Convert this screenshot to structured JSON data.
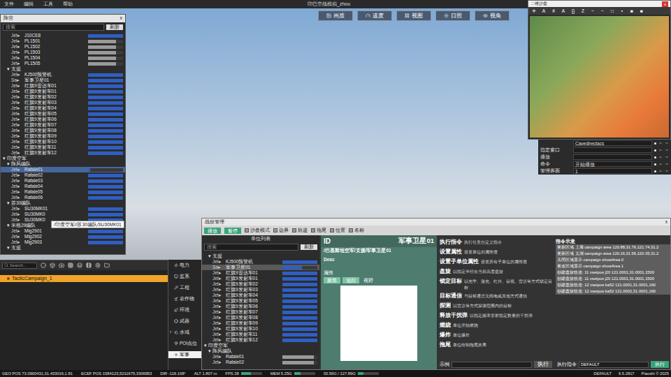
{
  "window": {
    "title": "印巴空战模拟_zhou"
  },
  "menu": [
    "文件",
    "编辑",
    "工具",
    "帮助"
  ],
  "viewport_toolbar": [
    {
      "label": "画质"
    },
    {
      "label": "速度"
    },
    {
      "label": "视图"
    },
    {
      "label": "日照"
    },
    {
      "label": "视角"
    }
  ],
  "camp_panel": {
    "title": "阵营",
    "close": "x",
    "search": {
      "placeholder": "搜索"
    },
    "refresh": "刷新",
    "rows": [
      {
        "kind": "unit",
        "indent": 2,
        "type": "Jet",
        "arrow": "▸",
        "name": "J10CE8",
        "level": 1,
        "color": "#2f5fc4",
        "selected": false
      },
      {
        "kind": "unit",
        "indent": 2,
        "type": "Jet",
        "arrow": "▸",
        "name": "PL1501",
        "level": 0.8,
        "color": "#9a9a9a",
        "selected": false
      },
      {
        "kind": "unit",
        "indent": 2,
        "type": "Jet",
        "arrow": "▸",
        "name": "PL1502",
        "level": 0.8,
        "color": "#9a9a9a",
        "selected": false
      },
      {
        "kind": "unit",
        "indent": 2,
        "type": "Jet",
        "arrow": "▸",
        "name": "PL1503",
        "level": 0.8,
        "color": "#9a9a9a",
        "selected": false
      },
      {
        "kind": "unit",
        "indent": 2,
        "type": "Jet",
        "arrow": "▸",
        "name": "PL1504",
        "level": 0.8,
        "color": "#9a9a9a",
        "selected": false
      },
      {
        "kind": "unit",
        "indent": 2,
        "type": "Jet",
        "arrow": "▸",
        "name": "PL1505",
        "level": 0.8,
        "color": "#9a9a9a",
        "selected": false
      },
      {
        "kind": "group",
        "indent": 1,
        "arrow": "▾",
        "name": "支援",
        "expanded": true,
        "selected": false
      },
      {
        "kind": "unit",
        "indent": 2,
        "type": "Jet",
        "arrow": "▸",
        "name": "KJ500预警机",
        "level": 1,
        "color": "#2f5fc4",
        "selected": false
      },
      {
        "kind": "unit",
        "indent": 2,
        "type": "Sa",
        "arrow": "▸",
        "name": "军事卫星01",
        "level": 1,
        "color": "#2f5fc4",
        "selected": false
      },
      {
        "kind": "unit",
        "indent": 2,
        "type": "Jet",
        "arrow": "▸",
        "name": "红旗9雷达车01",
        "level": 1,
        "color": "#2f5fc4",
        "selected": false
      },
      {
        "kind": "unit",
        "indent": 2,
        "type": "Jet",
        "arrow": "▸",
        "name": "红旗9发射车01",
        "level": 1,
        "color": "#2f5fc4",
        "selected": false
      },
      {
        "kind": "unit",
        "indent": 2,
        "type": "Jet",
        "arrow": "▸",
        "name": "红旗9发射车02",
        "level": 1,
        "color": "#2f5fc4",
        "selected": false
      },
      {
        "kind": "unit",
        "indent": 2,
        "type": "Jet",
        "arrow": "▸",
        "name": "红旗9发射车03",
        "level": 1,
        "color": "#2f5fc4",
        "selected": false
      },
      {
        "kind": "unit",
        "indent": 2,
        "type": "Jet",
        "arrow": "▸",
        "name": "红旗9发射车04",
        "level": 1,
        "color": "#2f5fc4",
        "selected": false
      },
      {
        "kind": "unit",
        "indent": 2,
        "type": "Jet",
        "arrow": "▸",
        "name": "红旗9发射车05",
        "level": 1,
        "color": "#2f5fc4",
        "selected": false
      },
      {
        "kind": "unit",
        "indent": 2,
        "type": "Jet",
        "arrow": "▸",
        "name": "红旗9发射车06",
        "level": 1,
        "color": "#2f5fc4",
        "selected": false
      },
      {
        "kind": "unit",
        "indent": 2,
        "type": "Jet",
        "arrow": "▸",
        "name": "红旗9发射车07",
        "level": 1,
        "color": "#2f5fc4",
        "selected": false
      },
      {
        "kind": "unit",
        "indent": 2,
        "type": "Jet",
        "arrow": "▸",
        "name": "红旗9发射车08",
        "level": 1,
        "color": "#2f5fc4",
        "selected": false
      },
      {
        "kind": "unit",
        "indent": 2,
        "type": "Jet",
        "arrow": "▸",
        "name": "红旗9发射车09",
        "level": 1,
        "color": "#2f5fc4",
        "selected": false
      },
      {
        "kind": "unit",
        "indent": 2,
        "type": "Jet",
        "arrow": "▸",
        "name": "红旗9发射车10",
        "level": 1,
        "color": "#2f5fc4",
        "selected": false
      },
      {
        "kind": "unit",
        "indent": 2,
        "type": "Jet",
        "arrow": "▸",
        "name": "红旗9发射车11",
        "level": 1,
        "color": "#2f5fc4",
        "selected": false
      },
      {
        "kind": "unit",
        "indent": 2,
        "type": "Jet",
        "arrow": "▸",
        "name": "红旗9发射车12",
        "level": 1,
        "color": "#2f5fc4",
        "selected": false
      },
      {
        "kind": "group",
        "indent": 0,
        "arrow": "▾",
        "name": "印度空军",
        "expanded": true,
        "selected": false
      },
      {
        "kind": "group",
        "indent": 1,
        "arrow": "▾",
        "name": "阵风编队",
        "expanded": true,
        "selected": false
      },
      {
        "kind": "unit",
        "indent": 2,
        "type": "Jet",
        "arrow": "▸",
        "name": "Rafale01",
        "level": 0.06,
        "color": "#2f5fc4",
        "selected": true
      },
      {
        "kind": "unit",
        "indent": 2,
        "type": "Jet",
        "arrow": "▸",
        "name": "Rafale02",
        "level": 1,
        "color": "#2f5fc4",
        "selected": false
      },
      {
        "kind": "unit",
        "indent": 2,
        "type": "Jet",
        "arrow": "▸",
        "name": "Rafale03",
        "level": 1,
        "color": "#2f5fc4",
        "selected": false
      },
      {
        "kind": "unit",
        "indent": 2,
        "type": "Jet",
        "arrow": "▸",
        "name": "Rafale04",
        "level": 1,
        "color": "#2f5fc4",
        "selected": false
      },
      {
        "kind": "unit",
        "indent": 2,
        "type": "Jet",
        "arrow": "▸",
        "name": "Rafale05",
        "level": 1,
        "color": "#2f5fc4",
        "selected": false
      },
      {
        "kind": "unit",
        "indent": 2,
        "type": "Jet",
        "arrow": "▸",
        "name": "Rafale06",
        "level": 1,
        "color": "#2f5fc4",
        "selected": false
      },
      {
        "kind": "group",
        "indent": 1,
        "arrow": "▾",
        "name": "苏30编队",
        "expanded": true,
        "selected": false
      },
      {
        "kind": "unit",
        "indent": 2,
        "type": "Jet",
        "arrow": "▸",
        "name": "SU30MK01",
        "level": 1,
        "color": "#2f5fc4",
        "selected": false
      },
      {
        "kind": "unit",
        "indent": 2,
        "type": "Jet",
        "arrow": "▸",
        "name": "SU30MK0",
        "level": 1,
        "color": "#2f5fc4",
        "selected": false
      },
      {
        "kind": "unit",
        "indent": 2,
        "type": "Jet",
        "arrow": "▸",
        "name": "SU30MK0",
        "level": 1,
        "color": "#2f5fc4",
        "selected": false
      },
      {
        "kind": "group",
        "indent": 1,
        "arrow": "▾",
        "name": "米格29编队",
        "expanded": true,
        "selected": false
      },
      {
        "kind": "unit",
        "indent": 2,
        "type": "Jet",
        "arrow": "▸",
        "name": "Mig2901",
        "level": 1,
        "color": "#2f5fc4",
        "selected": false
      },
      {
        "kind": "unit",
        "indent": 2,
        "type": "Jet",
        "arrow": "▸",
        "name": "Mig2902",
        "level": 1,
        "color": "#2f5fc4",
        "selected": false
      },
      {
        "kind": "unit",
        "indent": 2,
        "type": "Jet",
        "arrow": "▸",
        "name": "Mig2903",
        "level": 1,
        "color": "#2f5fc4",
        "selected": false
      },
      {
        "kind": "group",
        "indent": 1,
        "arrow": "▾",
        "name": "支援",
        "expanded": true,
        "selected": false
      }
    ]
  },
  "tooltip": "/印度空军//苏30编队/SU30MK01",
  "minimap": {
    "title": "二维沙盘",
    "close": "x",
    "tools": [
      "✛",
      "A",
      "#",
      "A",
      "{}",
      "Z",
      "~",
      "~",
      "□",
      "▪",
      "■",
      "■"
    ]
  },
  "props": [
    {
      "value": "Cavedirectacs"
    },
    {
      "label": "指定窗口"
    },
    {
      "label": "播放"
    },
    {
      "label": "命令",
      "value": "开始播放"
    },
    {
      "label": "管理界面",
      "value": "1"
    }
  ],
  "assets": {
    "search": {
      "placeholder": "Search..."
    },
    "items": [
      {
        "label": "TacticCampaign_1",
        "selected": true
      }
    ]
  },
  "categories": [
    {
      "label": "电力",
      "selected": false
    },
    {
      "label": "监系",
      "selected": false
    },
    {
      "label": "工程",
      "selected": false
    },
    {
      "label": "农作物",
      "selected": false
    },
    {
      "label": "环境",
      "selected": false
    },
    {
      "label": "武器",
      "selected": false
    },
    {
      "label": "水域",
      "arrow": "›",
      "selected": false
    },
    {
      "label": "POI点位",
      "selected": false
    },
    {
      "label": "军事",
      "selected": true
    }
  ],
  "battle": {
    "title": "战役管理",
    "close": "x",
    "buttons": [
      {
        "label": "播放"
      },
      {
        "label": "暂停"
      }
    ],
    "toggles": [
      {
        "label": "沙盘模式",
        "checked": false
      },
      {
        "label": "边界",
        "checked": false
      },
      {
        "label": "轨迹",
        "checked": false
      },
      {
        "label": "拖尾",
        "checked": false
      },
      {
        "label": "位置",
        "checked": false
      },
      {
        "label": "名称",
        "checked": false
      }
    ],
    "unit_list": {
      "title": "单位列表",
      "search": {
        "placeholder": "搜索"
      },
      "refresh": "刷新",
      "rows": [
        {
          "kind": "group",
          "indent": 1,
          "arrow": "▾",
          "name": "支援",
          "expanded": true,
          "selected": false
        },
        {
          "kind": "unit",
          "indent": 2,
          "type": "Jet",
          "arrow": "▸",
          "name": "KJ500预警机",
          "level": 1,
          "color": "#2f5fc4",
          "selected": false
        },
        {
          "kind": "unit",
          "indent": 2,
          "type": "Sa",
          "arrow": "▸",
          "name": "军事卫星01",
          "level": 0.55,
          "color": "#2f5fc4",
          "selected": true
        },
        {
          "kind": "unit",
          "indent": 2,
          "type": "Jet",
          "arrow": "▸",
          "name": "红旗9雷达车01",
          "level": 1,
          "color": "#2f5fc4",
          "selected": false
        },
        {
          "kind": "unit",
          "indent": 2,
          "type": "Jet",
          "arrow": "▸",
          "name": "红旗9发射车01",
          "level": 1,
          "color": "#2f5fc4",
          "selected": false
        },
        {
          "kind": "unit",
          "indent": 2,
          "type": "Jet",
          "arrow": "▸",
          "name": "红旗9发射车02",
          "level": 1,
          "color": "#2f5fc4",
          "selected": false
        },
        {
          "kind": "unit",
          "indent": 2,
          "type": "Jet",
          "arrow": "▸",
          "name": "红旗9发射车03",
          "level": 1,
          "color": "#2f5fc4",
          "selected": false
        },
        {
          "kind": "unit",
          "indent": 2,
          "type": "Jet",
          "arrow": "▸",
          "name": "红旗9发射车04",
          "level": 1,
          "color": "#2f5fc4",
          "selected": false
        },
        {
          "kind": "unit",
          "indent": 2,
          "type": "Jet",
          "arrow": "▸",
          "name": "红旗9发射车05",
          "level": 1,
          "color": "#2f5fc4",
          "selected": false
        },
        {
          "kind": "unit",
          "indent": 2,
          "type": "Jet",
          "arrow": "▸",
          "name": "红旗9发射车06",
          "level": 1,
          "color": "#2f5fc4",
          "selected": false
        },
        {
          "kind": "unit",
          "indent": 2,
          "type": "Jet",
          "arrow": "▸",
          "name": "红旗9发射车07",
          "level": 1,
          "color": "#2f5fc4",
          "selected": false
        },
        {
          "kind": "unit",
          "indent": 2,
          "type": "Jet",
          "arrow": "▸",
          "name": "红旗9发射车08",
          "level": 1,
          "color": "#2f5fc4",
          "selected": false
        },
        {
          "kind": "unit",
          "indent": 2,
          "type": "Jet",
          "arrow": "▸",
          "name": "红旗9发射车09",
          "level": 1,
          "color": "#2f5fc4",
          "selected": false
        },
        {
          "kind": "unit",
          "indent": 2,
          "type": "Jet",
          "arrow": "▸",
          "name": "红旗9发射车10",
          "level": 1,
          "color": "#2f5fc4",
          "selected": false
        },
        {
          "kind": "unit",
          "indent": 2,
          "type": "Jet",
          "arrow": "▸",
          "name": "红旗9发射车11",
          "level": 1,
          "color": "#2f5fc4",
          "selected": false
        },
        {
          "kind": "unit",
          "indent": 2,
          "type": "Jet",
          "arrow": "▸",
          "name": "红旗9发射车12",
          "level": 1,
          "color": "#2f5fc4",
          "selected": false
        },
        {
          "kind": "group",
          "indent": 0,
          "arrow": "▾",
          "name": "印度空军",
          "expanded": true,
          "selected": false
        },
        {
          "kind": "group",
          "indent": 1,
          "arrow": "▾",
          "name": "阵风编队",
          "expanded": true,
          "selected": false
        },
        {
          "kind": "unit",
          "indent": 2,
          "type": "Jet",
          "arrow": "▸",
          "name": "Rafale01",
          "level": 0.9,
          "color": "#9a9a9a",
          "selected": false
        },
        {
          "kind": "unit",
          "indent": 2,
          "type": "Jet",
          "arrow": "▸",
          "name": "Rafale02",
          "level": 0.9,
          "color": "#9a9a9a",
          "selected": false
        }
      ]
    },
    "info": {
      "id_label": "ID",
      "name": "军事卫星01",
      "path": "/巴基斯坦空军/支援/军事卫星01",
      "desc_label": "Desc",
      "attr_label": "属性",
      "tabs": [
        {
          "label": "聚焦",
          "selected": true
        },
        {
          "label": "追踪",
          "selected": true
        },
        {
          "label": "视野",
          "selected": false
        }
      ]
    },
    "commands": [
      {
        "name": "执行指令",
        "desc": "执行任意自定义指令"
      },
      {
        "name": "设置属性",
        "desc": "设置单位的属性值"
      },
      {
        "name": "设置子单位属性",
        "desc": "设置所有子单位的属性值"
      },
      {
        "name": "盘旋",
        "desc": "以指定半径在当前高度盘旋"
      },
      {
        "name": "锁定目标",
        "desc": "以光学、激光、红外、目视、雷达等方式锁定目标"
      },
      {
        "name": "目标通信",
        "desc": "与目标通过无线电或其他方式通信"
      },
      {
        "name": "探测",
        "desc": "以雷达等方式探测范围内的目标"
      },
      {
        "name": "释放干扰弹",
        "desc": "以指定频率发射指定数量的干扰弹"
      },
      {
        "name": "燃烧",
        "desc": "单位开始燃烧"
      },
      {
        "name": "爆炸",
        "desc": "单位爆炸"
      },
      {
        "name": "拖尾",
        "desc": "单位绘制拖尾效果"
      }
    ],
    "examples": {
      "title": "指令示意",
      "items": [
        "更新区域 上海 campaign area 120.88,31.76,121.74,31.2",
        "更新区域 太湖 campaign area 120.16,31.56,120.35,31.2",
        "关闭区域显示 campaign showArea 0",
        "更改区域显示 campaign showArea 1",
        "创建盘旋轨道: 11 xsetpos j20 121.0001,31.0001,1500",
        "创建盘旋轨道: 11 xsetpos j20 121.0001,31.0001,1500",
        "创建盘旋轨道: 12 xsetpos ka52 121.0001,31.0001,160",
        "创建盘旋轨道: 12 xsetpos ka52 121.0002,31.0001,160"
      ]
    },
    "footer": {
      "example_label": "示例",
      "run": "执行",
      "cmd_label": "执行指令",
      "channel": "DEFAULT",
      "run2": "执行"
    }
  },
  "status_bar": {
    "left": [
      {
        "text": "GEO POS  73.0900431,31.433016,1.81"
      },
      {
        "text": "ECEF POS  1584123,5211675,3306953"
      },
      {
        "text": "DIR  -119.108°"
      },
      {
        "text": "ALT  1.807 m"
      },
      {
        "text": "FPS  28",
        "level": 0.47
      },
      {
        "text": "MEM  5.25G",
        "level": 0.3
      },
      {
        "text": "33.56G / 127.89G",
        "level": 0.26
      }
    ],
    "right": [
      {
        "text": "DEFAULT"
      },
      {
        "text": "6.5.2817"
      },
      {
        "text": "Piaoshi © 2025"
      }
    ]
  }
}
